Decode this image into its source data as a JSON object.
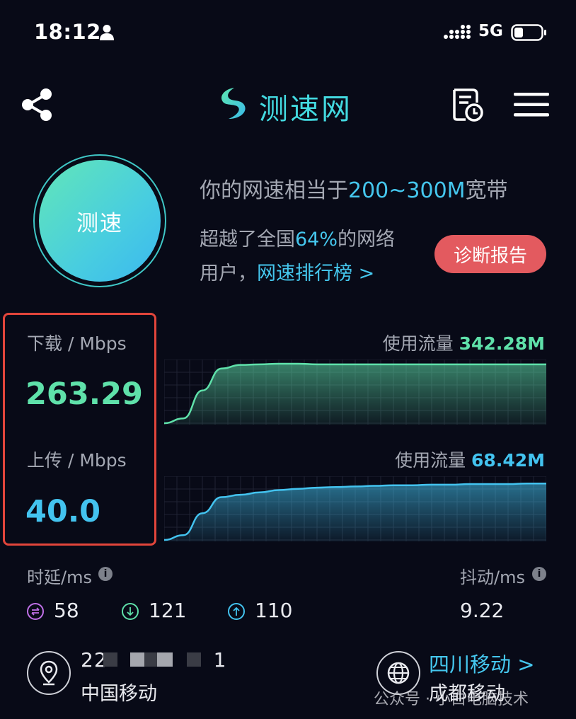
{
  "status_bar": {
    "time": "18:12",
    "network": "5G"
  },
  "header": {
    "title": "测速网"
  },
  "test_button": {
    "label": "测速"
  },
  "summary": {
    "line1_prefix": "你的网速相当于",
    "line1_highlight": "200~300M",
    "line1_suffix": "宽带",
    "line2_prefix": "超越了全国",
    "line2_highlight": "64%",
    "line2_suffix": "的网络",
    "line3_prefix": "用户，",
    "line3_link": "网速排行榜 >"
  },
  "diagnose_button": {
    "label": "诊断报告"
  },
  "download": {
    "label": "下载 / Mbps",
    "value": "263.29",
    "usage_label": "使用流量",
    "usage_value": "342.28M"
  },
  "upload": {
    "label": "上传 / Mbps",
    "value": "40.0",
    "usage_label": "使用流量",
    "usage_value": "68.42M"
  },
  "latency": {
    "label": "时延/ms",
    "ping": "58",
    "download": "121",
    "upload": "110"
  },
  "jitter": {
    "label": "抖动/ms",
    "value": "9.22"
  },
  "location": {
    "ip_start": "22",
    "ip_end": "1",
    "isp": "中国移动",
    "province_link": "四川移动 >",
    "city": "成都移动"
  },
  "watermark": "公众号 · 小白电脑技术",
  "colors": {
    "background": "#080a17",
    "download_accent": "#5fe1aa",
    "upload_accent": "#43c3ef",
    "diagnose_button": "#e35a5f",
    "highlight_box": "#e2453b"
  },
  "chart_data": [
    {
      "type": "area",
      "name": "download",
      "x": [
        0,
        1,
        2,
        3,
        4,
        5,
        6,
        7,
        8,
        9,
        10,
        11,
        12,
        13,
        14,
        15,
        16,
        17,
        18,
        19,
        20
      ],
      "values": [
        0,
        8,
        55,
        92,
        98,
        99,
        100,
        100,
        99,
        99,
        99,
        99,
        99,
        99,
        99,
        99,
        99,
        99,
        99,
        99,
        99
      ],
      "ylim": [
        0,
        100
      ],
      "grid": true
    },
    {
      "type": "area",
      "name": "upload",
      "x": [
        0,
        1,
        2,
        3,
        4,
        5,
        6,
        7,
        8,
        9,
        10,
        11,
        12,
        13,
        14,
        15,
        16,
        17,
        18,
        19,
        20
      ],
      "values": [
        0,
        8,
        45,
        72,
        76,
        80,
        84,
        86,
        88,
        89,
        90,
        91,
        92,
        92,
        93,
        93,
        94,
        94,
        94,
        95,
        95
      ],
      "ylim": [
        0,
        100
      ],
      "grid": true
    }
  ]
}
